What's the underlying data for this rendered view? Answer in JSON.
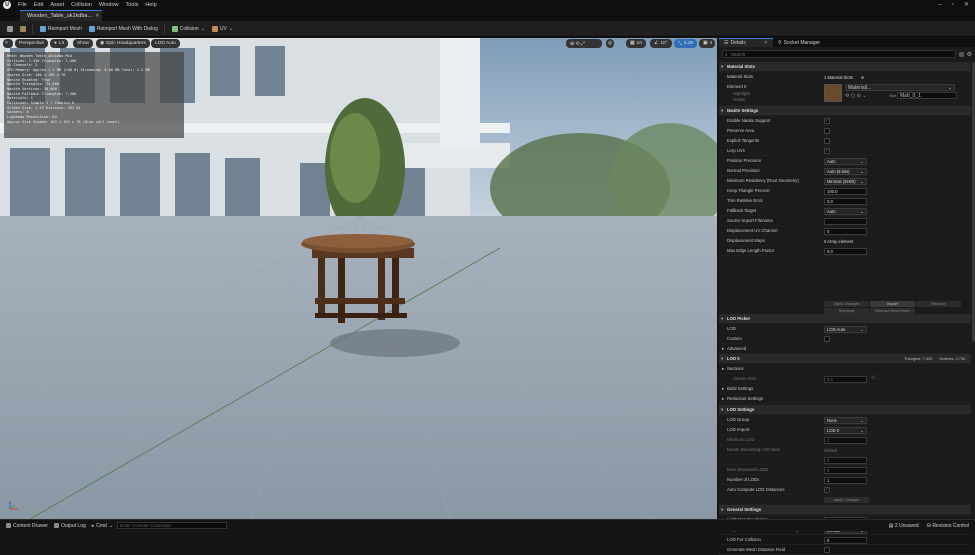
{
  "menubar": {
    "logo": "U",
    "items": [
      "File",
      "Edit",
      "Asset",
      "Collision",
      "Window",
      "Tools",
      "Help"
    ]
  },
  "tab": {
    "title": "Wooden_Table_uk1kdba..."
  },
  "toolbar": {
    "reimport": "Reimport Mesh",
    "reimport_dialog": "Reimport Mesh With Dialog",
    "collision": "Collision",
    "uv": "UV"
  },
  "viewport_toolbar": {
    "perspective": "Perspective",
    "lit": "Lit",
    "show": "Show",
    "epic": "Epic Headquarters",
    "lod": "LOD Auto",
    "right": [
      "10",
      "10°",
      "0.25",
      "4"
    ]
  },
  "stats": [
    "Mesh: Wooden_Table_uk1kdba_Mid",
    "Vertices:  7,430  Triangles:  7,400",
    "UV Channels: 2",
    "GPU Memory: Approx 1.2 MB (LOD 0)  Streaming: 0.00 MB  Total: 1.2 MB",
    "Approx Size: 100 x 100 x 76",
    "Nanite Enabled: True",
    "Nanite Triangles: 74,000",
    "Nanite Vertices: 38,000",
    "Nanite Fallback Triangles: 7,400",
    "Materials: 1",
    "Collision: Simple 1 / Complex 0",
    "Screen Size: 1.43  Distance: 201.54",
    "Sockets: 0",
    "Lightmap Resolution: 64",
    "Approx Size Shaded: 103 x 103 x 78 (Draw call count)"
  ],
  "panel": {
    "tabs": [
      "Details",
      "Socket Manager"
    ],
    "search_placeholder": "Search",
    "material_slots": {
      "section": "Material Slots",
      "slots_label": "Material Slots",
      "slots_value": "1 Material Slots",
      "element": "Element 0",
      "highlight": "Highlight",
      "isolate": "Isolate",
      "material_name": "MaterialI...",
      "slot_label": "Slot",
      "slot_name": "MatI_0_1"
    },
    "nanite": {
      "section": "Nanite Settings",
      "rows": [
        {
          "label": "Enable Nanite Support",
          "type": "check",
          "checked": true
        },
        {
          "label": "Preserve Area",
          "type": "check",
          "checked": false
        },
        {
          "label": "Explicit Tangents",
          "type": "check",
          "checked": false
        },
        {
          "label": "Lerp UVs",
          "type": "check",
          "checked": true
        },
        {
          "label": "Position Precision",
          "type": "drop",
          "value": "Auto"
        },
        {
          "label": "Normal Precision",
          "type": "drop",
          "value": "Auto (8 bits)"
        },
        {
          "label": "Minimum Residency (Root Geometry)",
          "type": "drop",
          "value": "Minimal (32KB)"
        },
        {
          "label": "Keep Triangle Percent",
          "type": "field",
          "value": "100.0"
        },
        {
          "label": "Trim Relative Error",
          "type": "field",
          "value": "0.0"
        },
        {
          "label": "Fallback Target",
          "type": "drop",
          "value": "Auto"
        },
        {
          "label": "Source Import Filename",
          "type": "field",
          "value": ""
        },
        {
          "label": "Displacement UV Channel",
          "type": "field",
          "value": "0"
        },
        {
          "label": "Displacement Maps",
          "type": "text",
          "value": "0 Array element"
        },
        {
          "label": "Max Edge Length Factor",
          "type": "field",
          "value": "0.0"
        }
      ],
      "buttons": [
        "Apply Changes",
        "Import",
        "Remove",
        "Reimport",
        "Remove Hires Mesh"
      ]
    },
    "lod_picker": {
      "section": "LOD Picker",
      "lod_label": "LOD",
      "lod_value": "LOD Auto",
      "custom": "Custom",
      "advanced": "Advanced"
    },
    "lod0": {
      "section": "LOD 0",
      "triangles": "Triangles: 7,400",
      "vertices": "Vertices: 4,730",
      "sections": "Sections",
      "screen_size": "Screen Size",
      "screen_size_value": "0.0",
      "build_settings": "Build Settings",
      "reduction": "Reduction Settings"
    },
    "lod_settings": {
      "section": "LOD Settings",
      "rows": [
        {
          "label": "LOD Group",
          "type": "drop",
          "value": "None"
        },
        {
          "label": "LOD Import",
          "type": "drop",
          "value": "LOD 0"
        },
        {
          "label": "Minimum LOD",
          "type": "field",
          "value": "0",
          "dim": true
        },
        {
          "label": "Nanite Streaming LOD Bias",
          "type": "text",
          "value": "Default",
          "dim": true
        },
        {
          "label": "",
          "type": "field",
          "value": "0",
          "dim": true
        },
        {
          "label": "Num Streamed LODs",
          "type": "field",
          "value": "0",
          "dim": true
        },
        {
          "label": "Number of LODs",
          "type": "field",
          "value": "1"
        },
        {
          "label": "Auto Compute LOD Distances",
          "type": "check",
          "checked": true
        }
      ],
      "apply": "Apply Changes"
    },
    "general": {
      "section": "General Settings",
      "rows": [
        {
          "label": "Light Map Resolution",
          "type": "field",
          "value": "4"
        },
        {
          "label": "Support Uniform Color Mesh Painting",
          "type": "drop",
          "value": "Default"
        },
        {
          "label": "LOD For Collision",
          "type": "field",
          "value": "0"
        },
        {
          "label": "Generate Mesh Distance Field",
          "type": "check",
          "checked": false
        }
      ]
    }
  },
  "bottombar": {
    "content_drawer": "Content Drawer",
    "output_log": "Output Log",
    "cmd": "Cmd",
    "console_placeholder": "Enter Console Command",
    "unsaved": "2 Unsaved",
    "revision": "Revision Control"
  }
}
